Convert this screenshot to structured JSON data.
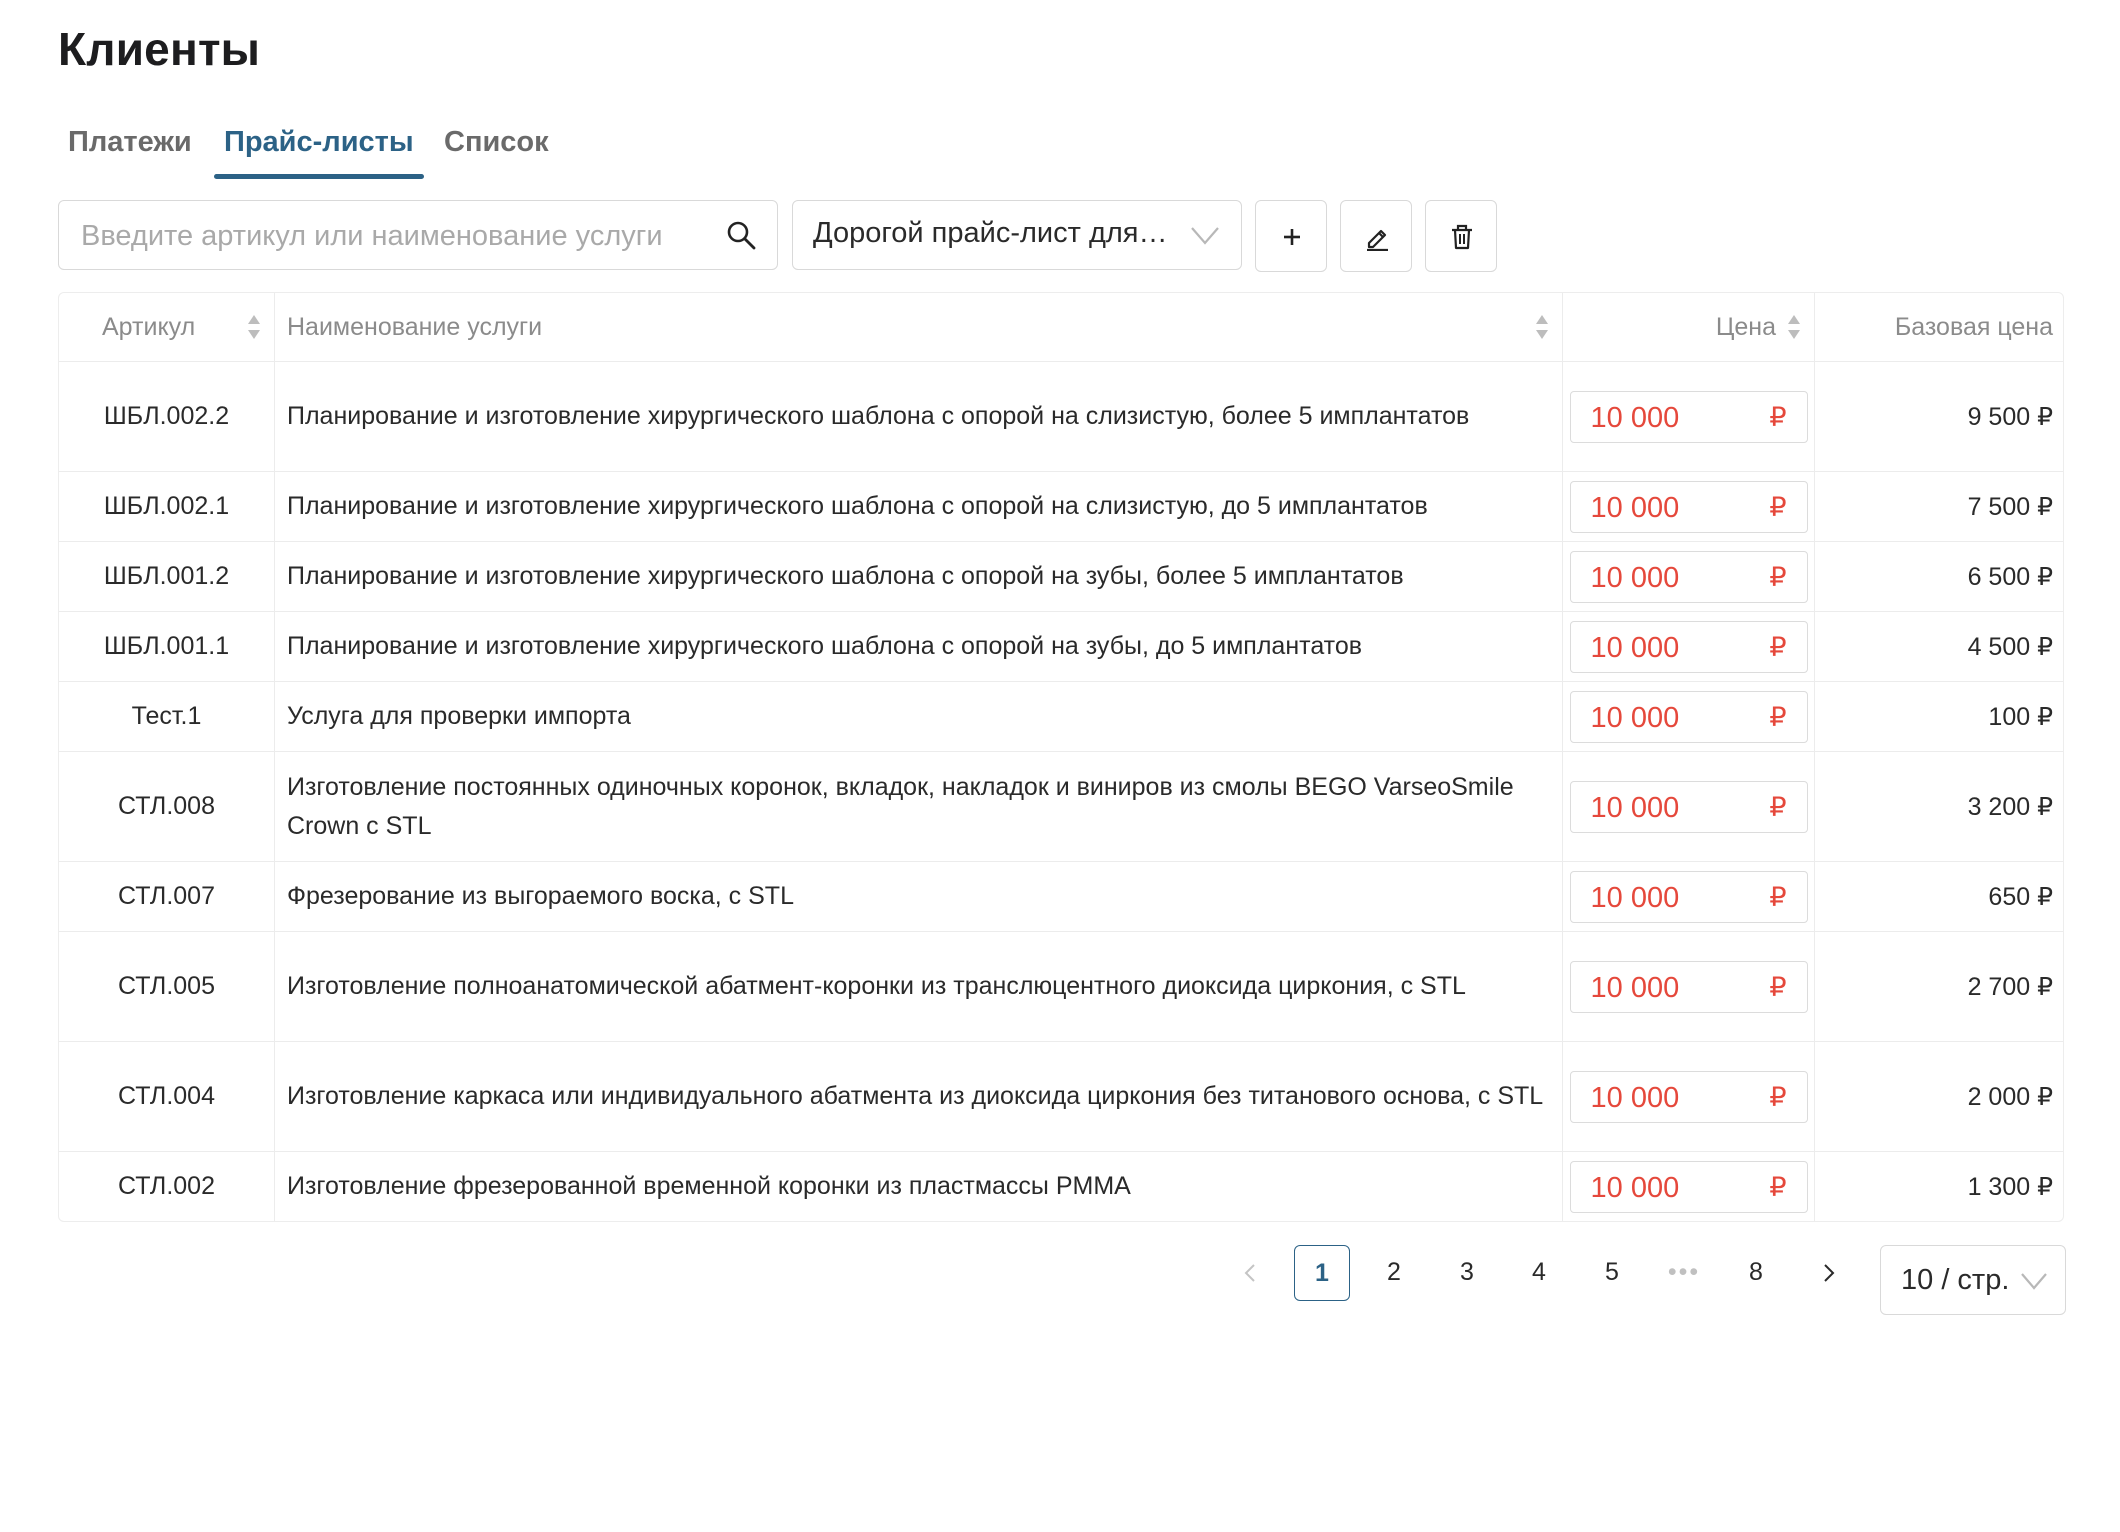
{
  "page": {
    "title": "Клиенты"
  },
  "tabs": [
    {
      "label": "Платежи",
      "active": false
    },
    {
      "label": "Прайс-листы",
      "active": true
    },
    {
      "label": "Список",
      "active": false
    }
  ],
  "toolbar": {
    "search_placeholder": "Введите артикул или наименование услуги",
    "search_value": "",
    "pricelist_selected": "Дорогой прайс-лист для…",
    "icons": {
      "search": "search-icon",
      "chevron": "chevron-down-icon",
      "add": "plus-icon",
      "edit": "pencil-icon",
      "delete": "trash-icon"
    }
  },
  "table": {
    "columns": [
      "Артикул",
      "Наименование услуги",
      "Цена",
      "Базовая цена"
    ],
    "currency": "₽",
    "rows": [
      {
        "article": "ШБЛ.002.2",
        "name": "Планирование и изготовление хирургического шаблона с опорой на слизистую, более 5 имплантатов",
        "price": "10 000",
        "base_price": "9 500 ₽"
      },
      {
        "article": "ШБЛ.002.1",
        "name": "Планирование и изготовление хирургического шаблона с опорой на слизистую, до 5 имплантатов",
        "price": "10 000",
        "base_price": "7 500 ₽"
      },
      {
        "article": "ШБЛ.001.2",
        "name": "Планирование и изготовление хирургического шаблона с опорой на зубы, более 5 имплантатов",
        "price": "10 000",
        "base_price": "6 500 ₽"
      },
      {
        "article": "ШБЛ.001.1",
        "name": "Планирование и изготовление хирургического шаблона с опорой на зубы, до 5 имплантатов",
        "price": "10 000",
        "base_price": "4 500 ₽"
      },
      {
        "article": "Тест.1",
        "name": "Услуга для проверки импорта",
        "price": "10 000",
        "base_price": "100 ₽"
      },
      {
        "article": "СТЛ.008",
        "name": "Изготовление постоянных одиночных коронок, вкладок, накладок и виниров из смолы BEGO VarseoSmile Crown с STL",
        "price": "10 000",
        "base_price": "3 200 ₽"
      },
      {
        "article": "СТЛ.007",
        "name": "Фрезерование из выгораемого воска, с STL",
        "price": "10 000",
        "base_price": "650 ₽"
      },
      {
        "article": "СТЛ.005",
        "name": "Изготовление полноанатомической абатмент-коронки из транслюцентного диоксида циркония, с STL",
        "price": "10 000",
        "base_price": "2 700 ₽"
      },
      {
        "article": "СТЛ.004",
        "name": "Изготовление каркаса или индивидуального абатмента из диоксида циркония без титанового основа, с STL",
        "price": "10 000",
        "base_price": "2 000 ₽"
      },
      {
        "article": "СТЛ.002",
        "name": "Изготовление фрезерованной временной коронки из пластмассы PMMA",
        "price": "10 000",
        "base_price": "1 300 ₽"
      }
    ]
  },
  "pagination": {
    "pages": [
      "1",
      "2",
      "3",
      "4",
      "5"
    ],
    "ellipsis": "•••",
    "last_page": "8",
    "current_page": "1",
    "page_size": "10 / стр."
  }
}
